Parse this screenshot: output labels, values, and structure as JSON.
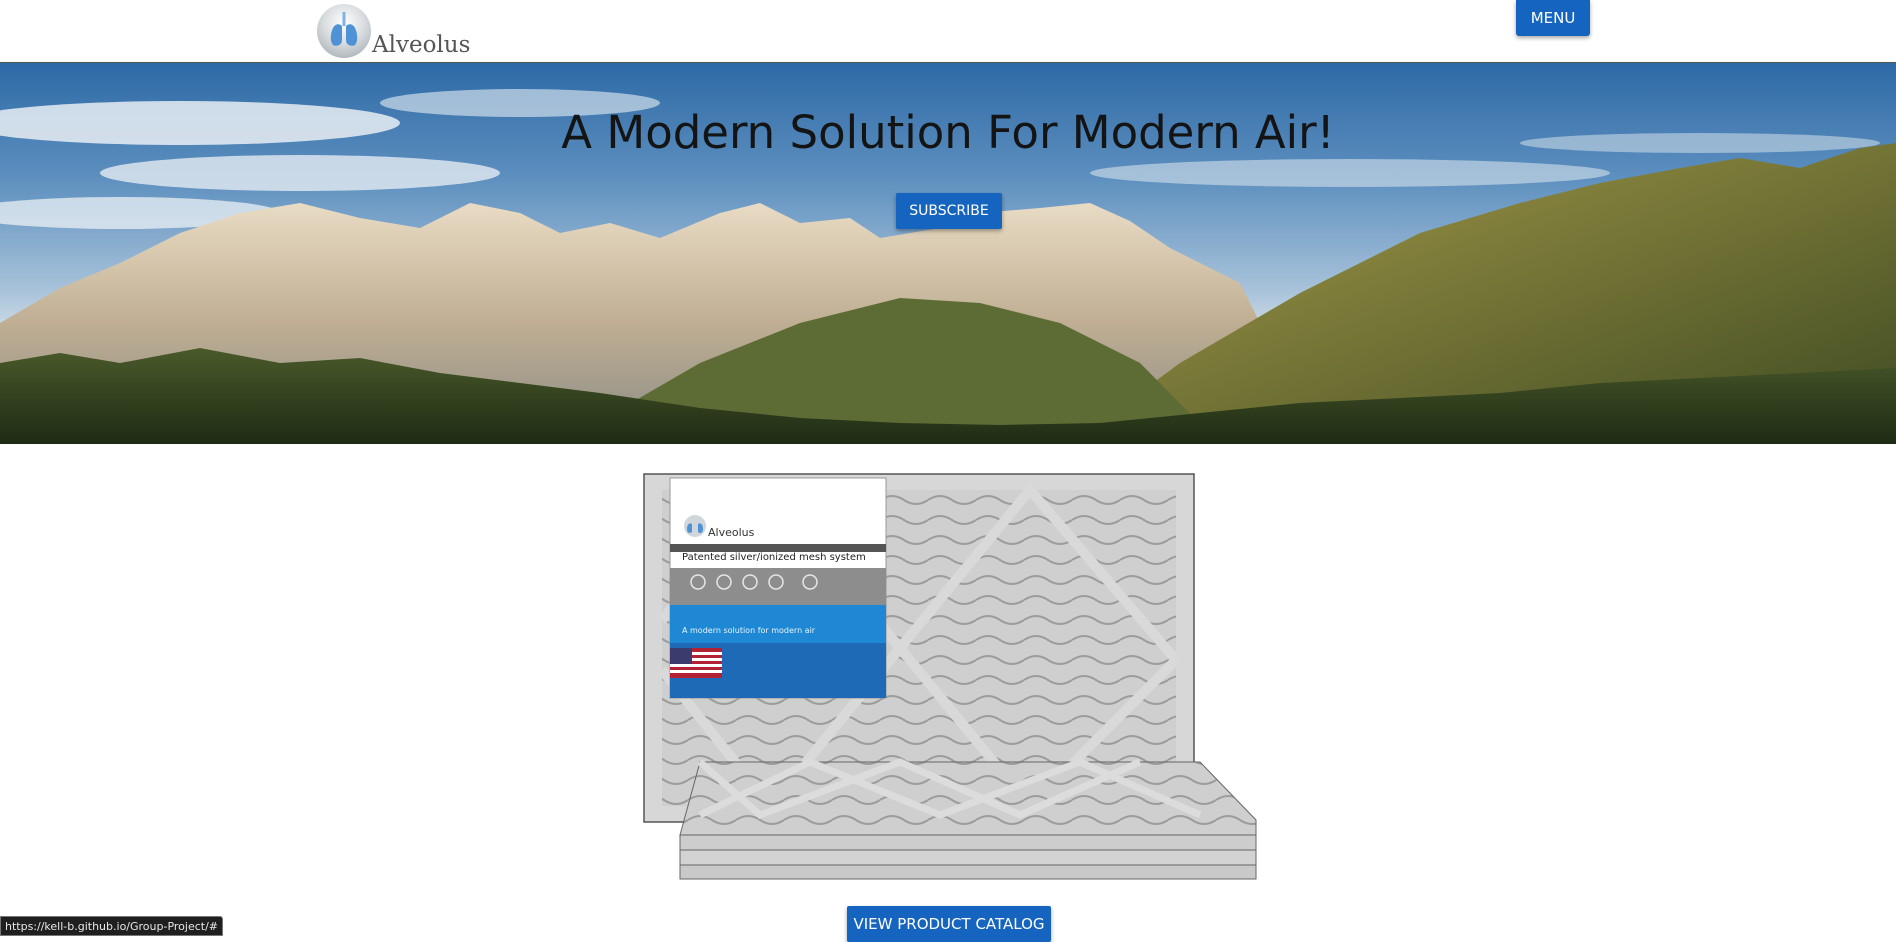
{
  "brand": {
    "name": "Alveolus"
  },
  "nav": {
    "menu_label": "MENU"
  },
  "hero": {
    "title": "A Modern Solution For Modern Air!",
    "subscribe_label": "SUBSCRIBE"
  },
  "product": {
    "package_brand": "Alveolus",
    "package_heading": "Patented silver/ionized mesh system",
    "package_tagline": "A modern solution for modern air"
  },
  "catalog": {
    "button_label": "VIEW PRODUCT CATALOG"
  },
  "status": {
    "url": "https://kell-b.github.io/Group-Project/#"
  },
  "colors": {
    "accent": "#1565c0",
    "package_blue": "#1e7fcf",
    "package_dark_blue": "#1f6ab7"
  },
  "icons": {
    "logo": "lungs-logo-icon",
    "flag": "us-flag-icon"
  }
}
